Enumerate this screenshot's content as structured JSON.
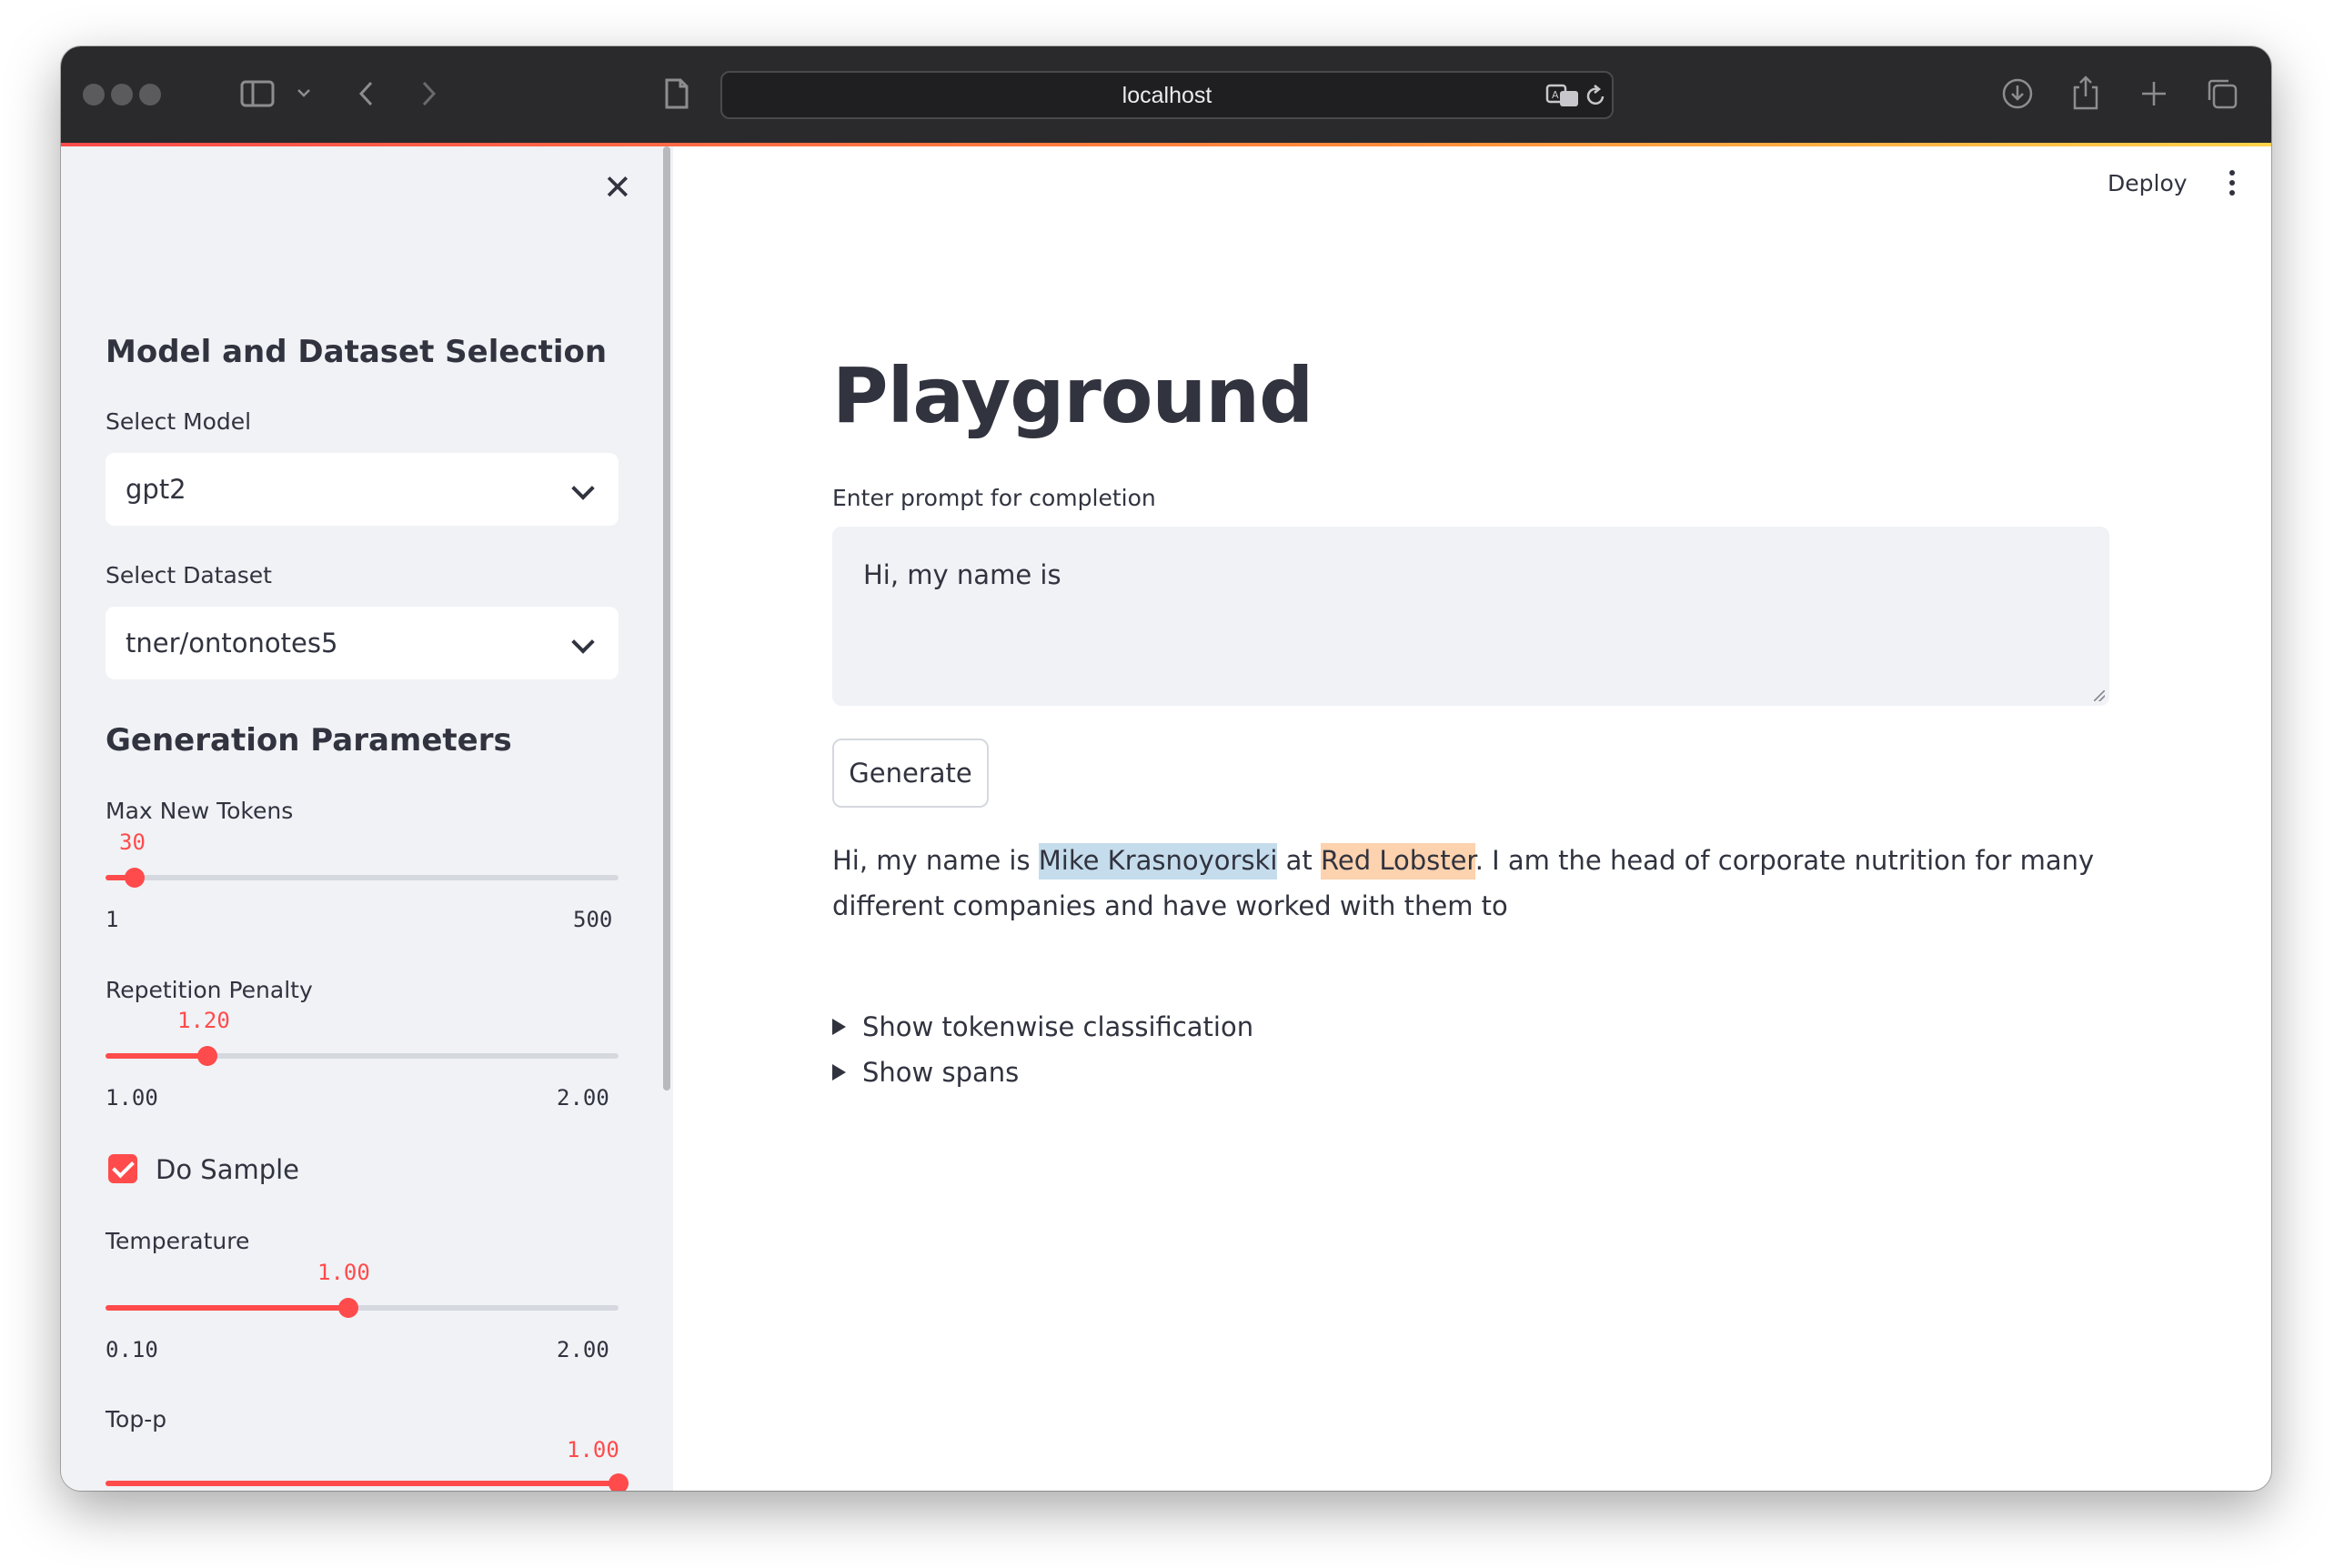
{
  "browser": {
    "url": "localhost",
    "icons": [
      "sidebar-toggle-icon",
      "chevron-down-icon",
      "back-icon",
      "forward-icon",
      "page-icon",
      "translate-icon",
      "reload-icon",
      "download-icon",
      "share-icon",
      "new-tab-icon",
      "tabs-overview-icon"
    ]
  },
  "sidebar": {
    "close_icon": "close-icon",
    "section_model": "Model and Dataset Selection",
    "select_model_label": "Select Model",
    "select_model_value": "gpt2",
    "select_dataset_label": "Select Dataset",
    "select_dataset_value": "tner/ontonotes5",
    "section_generation": "Generation Parameters",
    "max_new_tokens": {
      "label": "Max New Tokens",
      "value": "30",
      "min": "1",
      "max": "500"
    },
    "repetition_penalty": {
      "label": "Repetition Penalty",
      "value": "1.20",
      "min": "1.00",
      "max": "2.00"
    },
    "do_sample": {
      "label": "Do Sample",
      "checked": true
    },
    "temperature": {
      "label": "Temperature",
      "value": "1.00",
      "min": "0.10",
      "max": "2.00"
    },
    "top_p": {
      "label": "Top-p",
      "value": "1.00"
    }
  },
  "header": {
    "deploy_label": "Deploy",
    "menu_icon": "kebab-menu-icon"
  },
  "main": {
    "title": "Playground",
    "prompt_label": "Enter prompt for completion",
    "prompt_value": "Hi, my name is",
    "generate_label": "Generate",
    "output": {
      "prefix": "Hi, my name is ",
      "entity1": "Mike Krasnoyorski",
      "between": " at ",
      "entity2": "Red Lobster",
      "suffix": ". I am the head of corporate nutrition for many different companies and have worked with them to"
    },
    "expanders": [
      "Show tokenwise classification",
      "Show spans"
    ]
  },
  "colors": {
    "accent": "#ff4b4b",
    "entity1_bg": "#c5dcec",
    "entity2_bg": "#fdd2ae",
    "sidebar_bg": "#f0f2f6",
    "text": "#31333f"
  }
}
